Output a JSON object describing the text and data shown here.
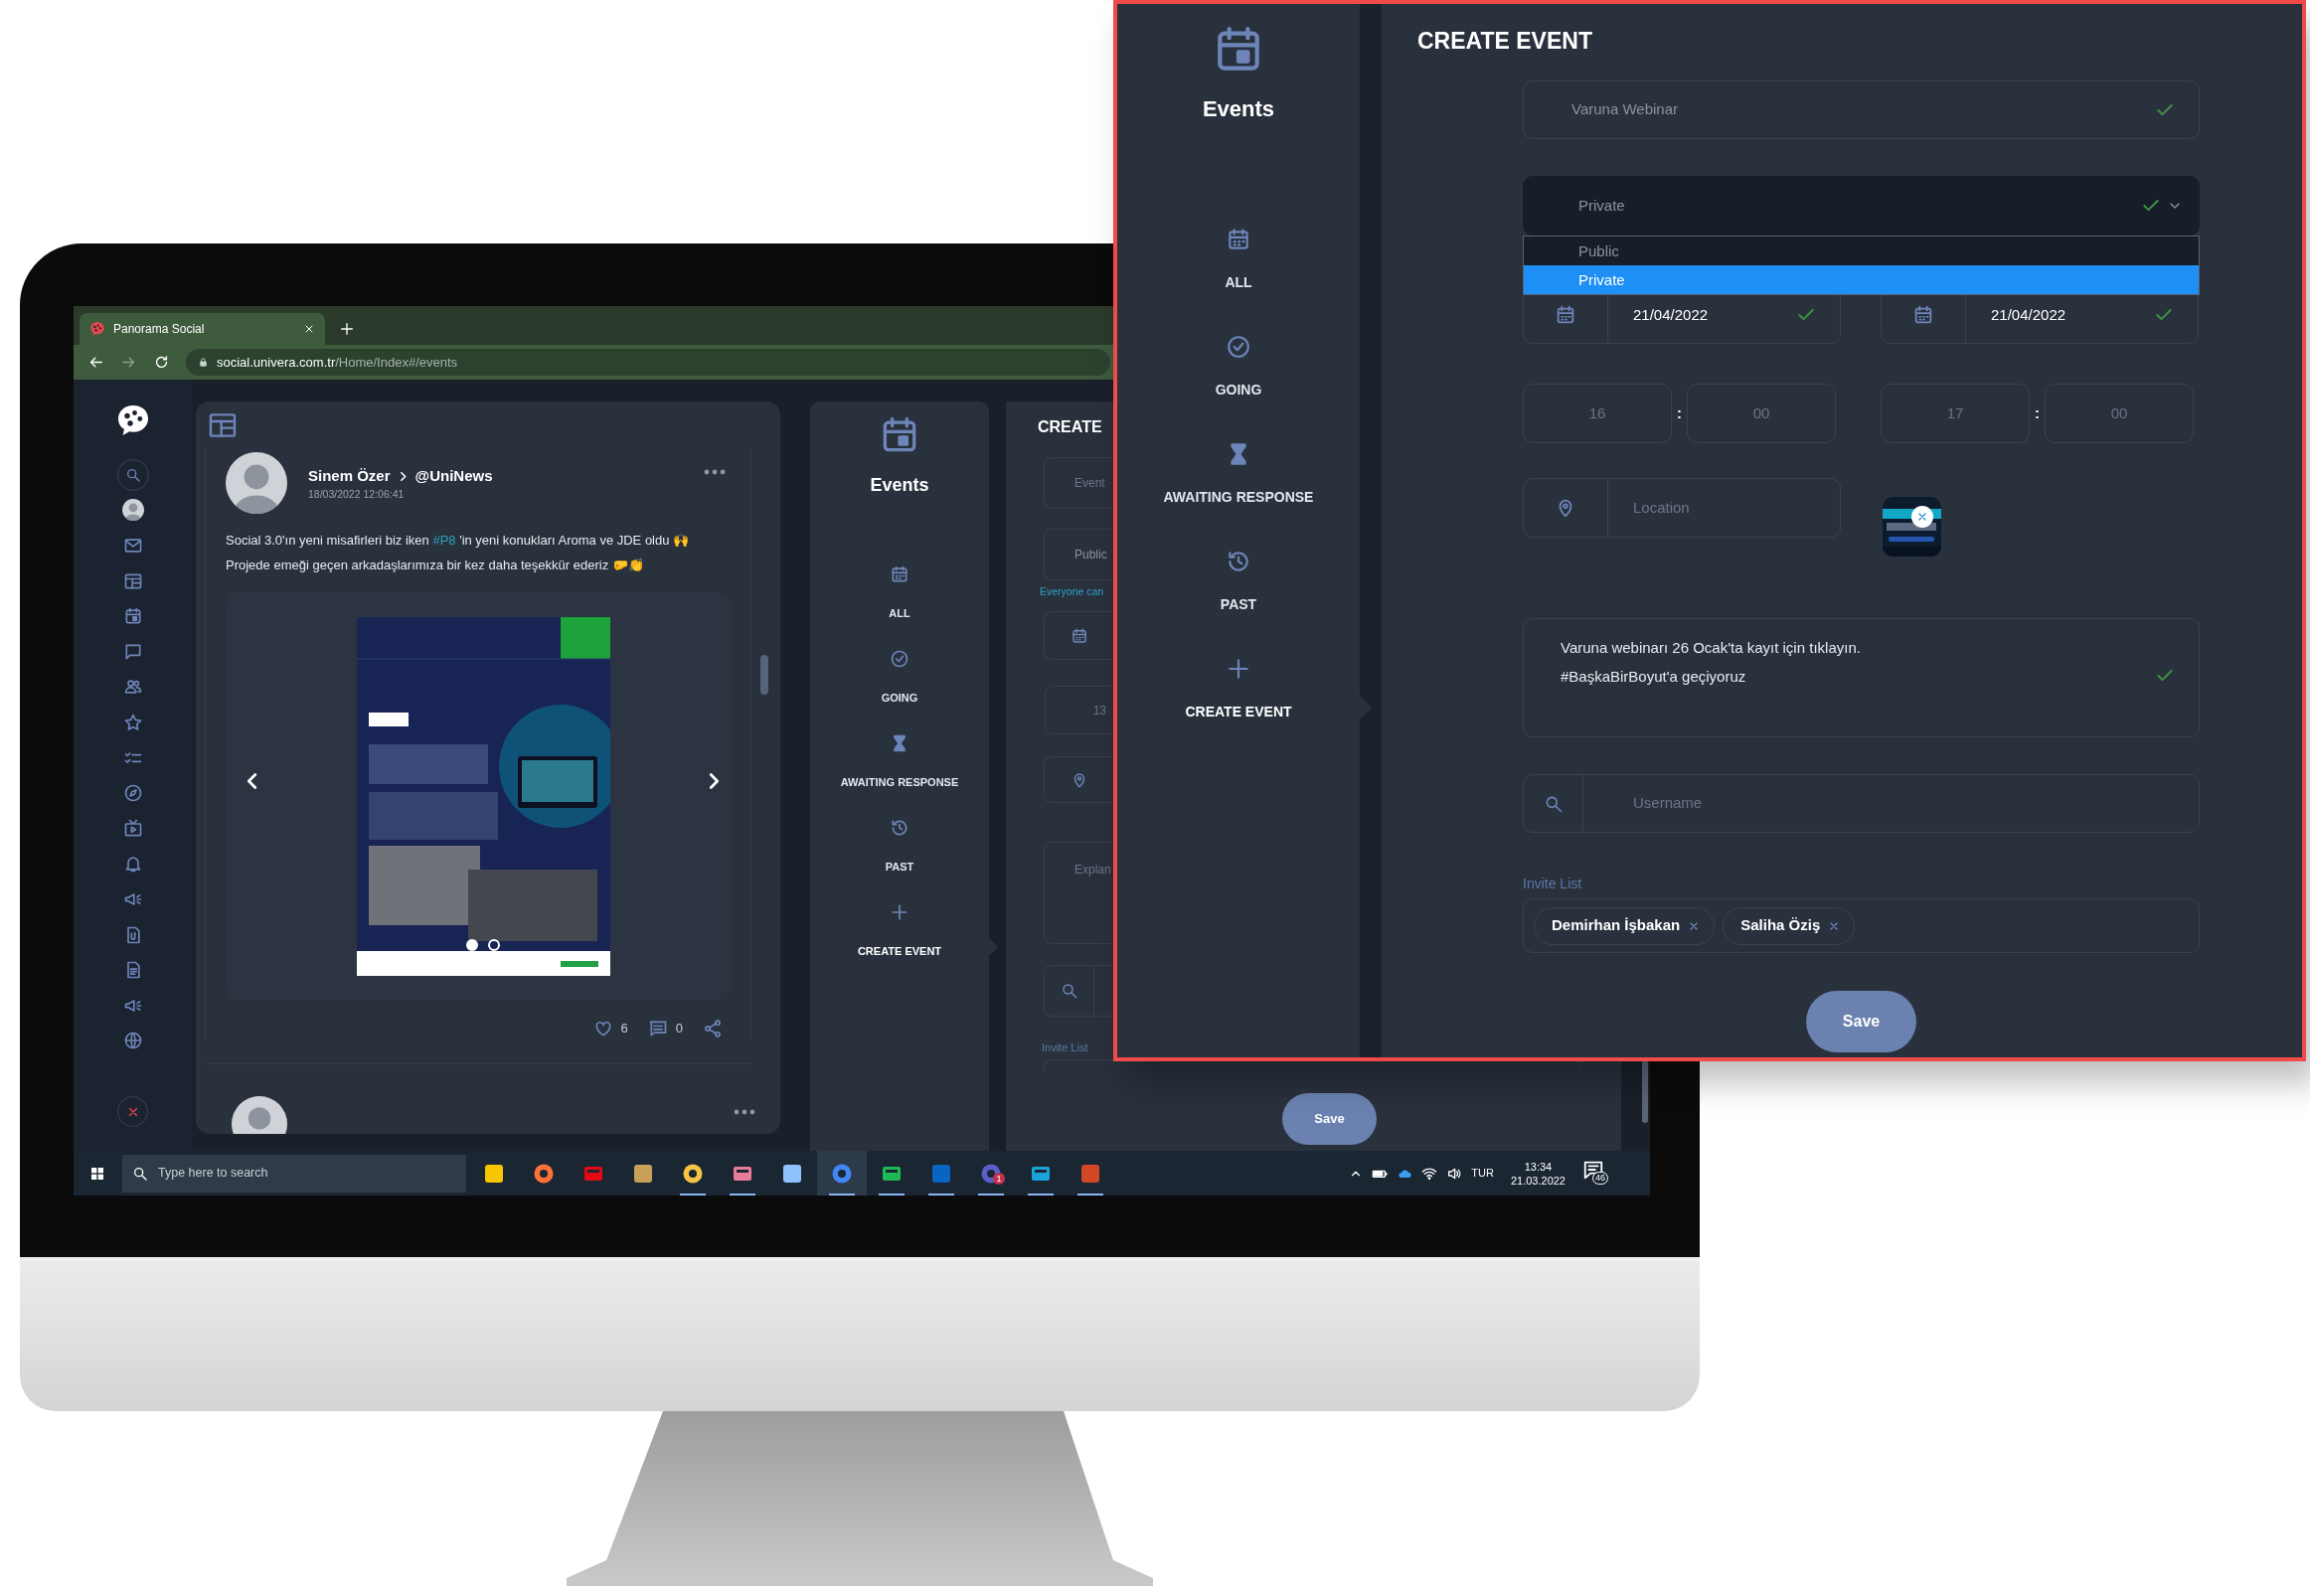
{
  "browser": {
    "tab_title": "Panorama Social",
    "url_host": "social.univera.com.tr",
    "url_path": "/Home/Index#/events"
  },
  "post": {
    "author": "Sinem Özer",
    "channel": "@UniNews",
    "timestamp": "18/03/2022 12:06:41",
    "text": [
      {
        "kind": "text",
        "text": "Social 3.0'ın yeni misafirleri biz iken "
      },
      {
        "kind": "hashtag",
        "text": "#P8"
      },
      {
        "kind": "text",
        "text": " 'in yeni konukları Aroma ve JDE oldu 🙌 Projede emeği geçen arkadaşlarımıza bir kez daha teşekkür ederiz 🤛👏"
      }
    ],
    "slides": [
      {
        "selected": true
      },
      {
        "selected": false
      }
    ],
    "likes": "6",
    "comments": "0"
  },
  "events_nav": {
    "title": "Events",
    "items": [
      {
        "label": "ALL",
        "selected": false
      },
      {
        "label": "GOING",
        "selected": false
      },
      {
        "label": "AWAITING RESPONSE",
        "selected": false
      },
      {
        "label": "PAST",
        "selected": false
      },
      {
        "label": "CREATE EVENT",
        "selected": true
      }
    ]
  },
  "create_panel": {
    "title": "CREATE",
    "name_placeholder": "Event",
    "type_value": "Public",
    "type_hint": "Everyone can",
    "start_hour": "13",
    "description_placeholder": "Explan",
    "invite_label": "Invite List",
    "save": "Save"
  },
  "taskbar": {
    "search_placeholder": "Type here to search",
    "apps": [
      {
        "running": false,
        "selected": false
      },
      {
        "running": false,
        "selected": false
      },
      {
        "running": false,
        "selected": false
      },
      {
        "running": false,
        "selected": false
      },
      {
        "running": true,
        "selected": false
      },
      {
        "running": true,
        "selected": false
      },
      {
        "running": false,
        "selected": false
      },
      {
        "running": true,
        "selected": true
      },
      {
        "running": true,
        "selected": false
      },
      {
        "running": true,
        "selected": false
      },
      {
        "running": true,
        "selected": false,
        "badge": "1"
      },
      {
        "running": true,
        "selected": false
      },
      {
        "running": true,
        "selected": false
      }
    ],
    "language": "TUR",
    "time": "13:34",
    "date": "21.03.2022",
    "notifications": "46"
  },
  "callout": {
    "nav": {
      "title": "Events",
      "items": [
        {
          "label": "ALL",
          "selected": false
        },
        {
          "label": "GOING",
          "selected": false
        },
        {
          "label": "AWAITING RESPONSE",
          "selected": false
        },
        {
          "label": "PAST",
          "selected": false
        },
        {
          "label": "CREATE EVENT",
          "selected": true
        }
      ]
    },
    "form": {
      "title": "CREATE EVENT",
      "event_name": {
        "value": "Varuna Webinar",
        "valid": true
      },
      "event_type": {
        "value": "Private",
        "valid": true,
        "expanded": true,
        "options": [
          {
            "label": "Public",
            "selected": false
          },
          {
            "label": "Private",
            "selected": true
          }
        ]
      },
      "start_date": {
        "value": "21/04/2022",
        "valid": true
      },
      "end_date": {
        "value": "21/04/2022",
        "valid": true
      },
      "start_time": {
        "hour": "16",
        "separator": ":",
        "minute": "00"
      },
      "end_time": {
        "hour": "17",
        "separator": ":",
        "minute": "00"
      },
      "location": {
        "placeholder": "Location"
      },
      "description": {
        "value": "Varuna webinarı 26 Ocak'ta kayıt için tıklayın.\n#BaşkaBirBoyut'a geçiyoruz",
        "valid": true
      },
      "username": {
        "placeholder": "Username"
      },
      "invite_label": "Invite List",
      "invitees": [
        "Demirhan İşbakan",
        "Saliha Öziş"
      ],
      "save": "Save"
    }
  }
}
